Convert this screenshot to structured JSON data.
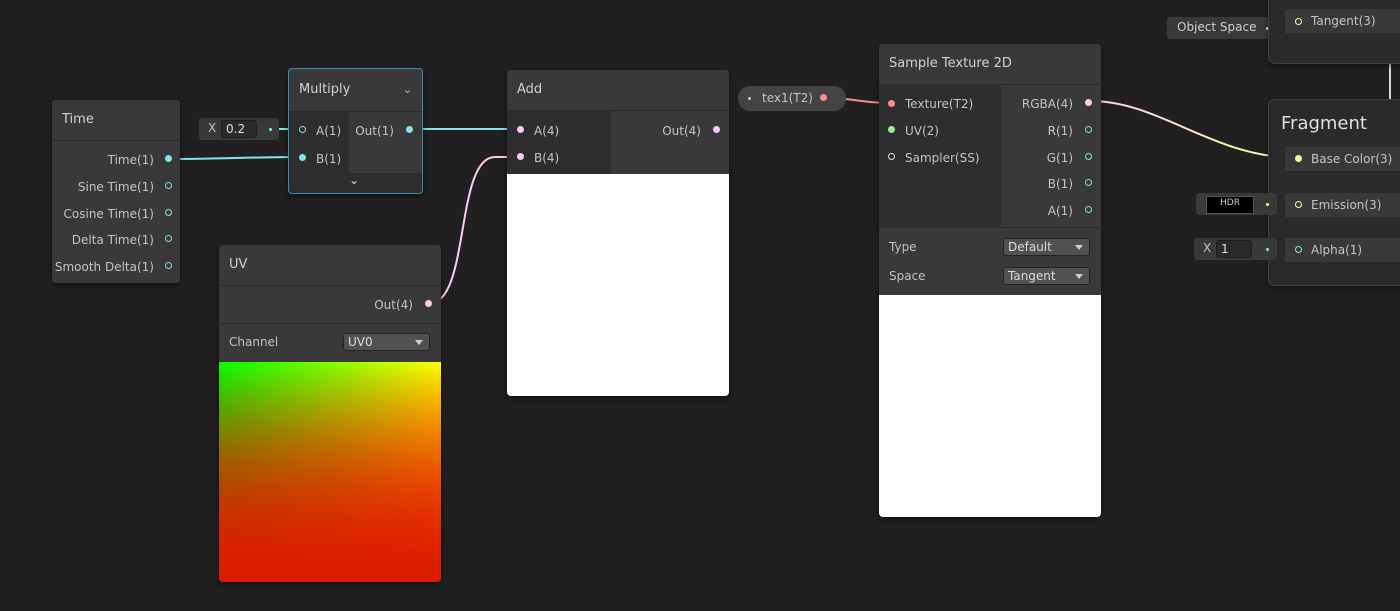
{
  "nodes": {
    "time": {
      "title": "Time",
      "outputs": [
        "Time(1)",
        "Sine Time(1)",
        "Cosine Time(1)",
        "Delta Time(1)",
        "Smooth Delta(1)"
      ]
    },
    "multiply": {
      "title": "Multiply",
      "input_x_label": "X",
      "input_x_value": "0.2",
      "inputs": [
        "A(1)",
        "B(1)"
      ],
      "output": "Out(1)"
    },
    "uv": {
      "title": "UV",
      "output": "Out(4)",
      "channel_label": "Channel",
      "channel_value": "UV0"
    },
    "add": {
      "title": "Add",
      "inputs": [
        "A(4)",
        "B(4)"
      ],
      "output": "Out(4)"
    },
    "property": {
      "label": "tex1(T2)"
    },
    "sample_texture": {
      "title": "Sample Texture 2D",
      "inputs": [
        "Texture(T2)",
        "UV(2)",
        "Sampler(SS)"
      ],
      "outputs": [
        "RGBA(4)",
        "R(1)",
        "G(1)",
        "B(1)",
        "A(1)"
      ],
      "type_label": "Type",
      "type_value": "Default",
      "space_label": "Space",
      "space_value": "Tangent"
    },
    "vertex": {
      "object_space_label": "Object Space",
      "tangent_port": "Tangent(3)"
    },
    "fragment": {
      "title": "Fragment",
      "ports": [
        "Base Color(3)",
        "Emission(3)",
        "Alpha(1)"
      ],
      "hdr_label": "HDR",
      "alpha_x_label": "X",
      "alpha_x_value": "1"
    }
  },
  "colors": {
    "float": "#84e4e7",
    "vector2": "#9aef92",
    "vector3": "#f6ff9a",
    "vector4": "#fbcbf4",
    "texture": "#ff8b8b",
    "sampler": "#dcdcdc",
    "selection": "#44c0ff"
  }
}
